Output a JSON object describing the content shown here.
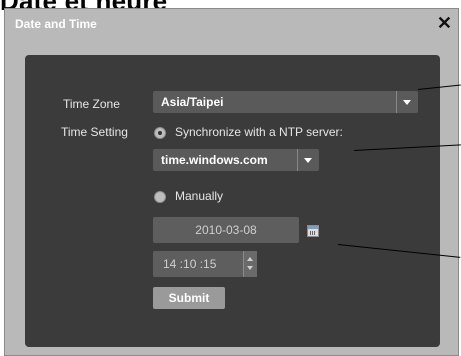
{
  "page_heading": "Date et heure",
  "dialog": {
    "title": "Date and Time",
    "close_glyph": "✕",
    "time_zone": {
      "label": "Time Zone",
      "value": "Asia/Taipei"
    },
    "time_setting": {
      "label": "Time Setting",
      "ntp_option": "Synchronize with a NTP server:",
      "ntp_server": "time.windows.com",
      "manual_option": "Manually",
      "date": "2010-03-08",
      "time": "14 :10 :15"
    },
    "submit_label": "Submit"
  }
}
